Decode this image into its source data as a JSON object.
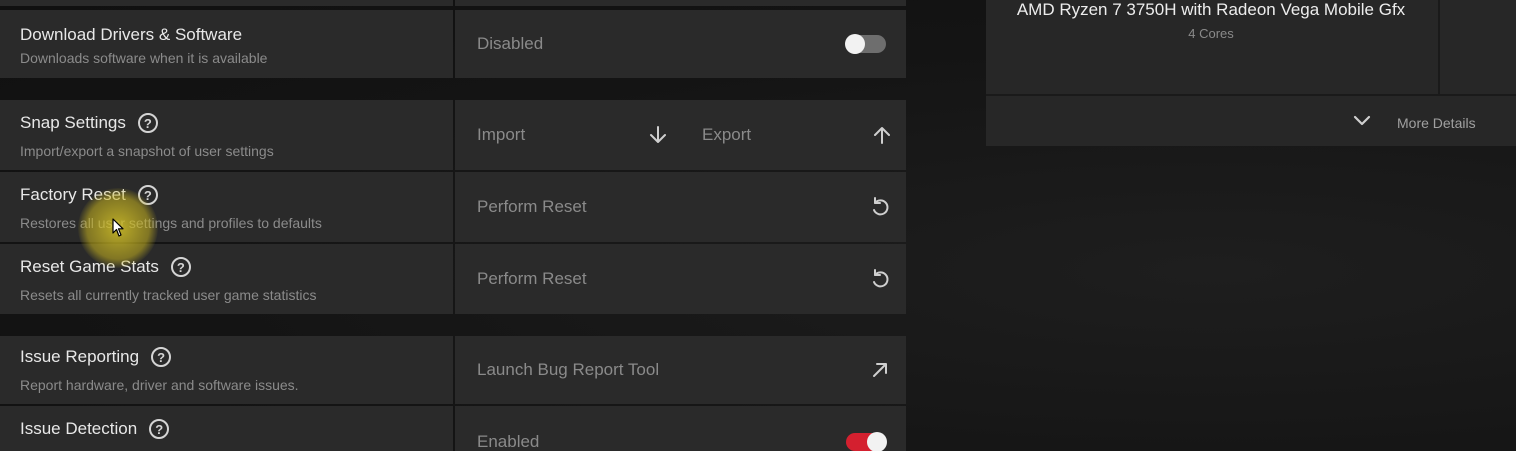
{
  "settings": {
    "download": {
      "title": "Download Drivers & Software",
      "desc": "Downloads software when it is available",
      "state": "Disabled",
      "toggle_on": false
    },
    "snap": {
      "title": "Snap Settings",
      "desc": "Import/export a snapshot of user settings",
      "import_label": "Import",
      "export_label": "Export"
    },
    "factory_reset": {
      "title": "Factory Reset",
      "desc": "Restores all user settings and profiles to defaults",
      "action": "Perform Reset"
    },
    "reset_game_stats": {
      "title": "Reset Game Stats",
      "desc": "Resets all currently tracked user game statistics",
      "action": "Perform Reset"
    },
    "issue_reporting": {
      "title": "Issue Reporting",
      "desc": "Report hardware, driver and software issues.",
      "action": "Launch Bug Report Tool"
    },
    "issue_detection": {
      "title": "Issue Detection",
      "state": "Enabled",
      "toggle_on": true
    }
  },
  "cpu": {
    "name": "AMD Ryzen 7 3750H with Radeon Vega Mobile Gfx",
    "cores": "4 Cores",
    "more_details_label": "More Details"
  },
  "colors": {
    "panel": "#2a2a2a",
    "accent": "#d4202f",
    "cursor_highlight": "#d6c428"
  }
}
